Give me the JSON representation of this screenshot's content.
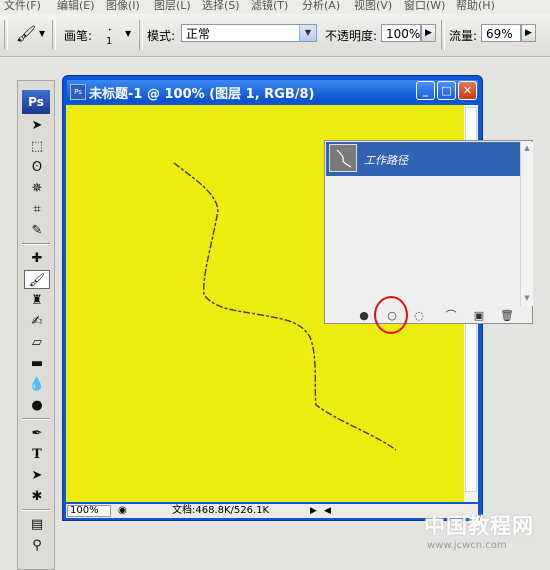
{
  "menu": [
    "文件(F)",
    "编辑(E)",
    "图像(I)",
    "图层(L)",
    "选择(S)",
    "滤镜(T)",
    "分析(A)",
    "视图(V)",
    "窗口(W)",
    "帮助(H)"
  ],
  "options": {
    "brush_label": "画笔:",
    "brush_size": "1",
    "mode_label": "模式:",
    "mode_value": "正常",
    "opacity_label": "不透明度:",
    "opacity_value": "100%",
    "flow_label": "流量:",
    "flow_value": "69%"
  },
  "toolbox": {
    "logo": "Ps",
    "tools": [
      "move-icon",
      "marquee-icon",
      "lasso-icon",
      "magic-wand-icon",
      "crop-icon",
      "slice-icon",
      "healing-brush-icon",
      "brush-icon",
      "clone-stamp-icon",
      "history-brush-icon",
      "eraser-icon",
      "gradient-icon",
      "blur-icon",
      "dodge-icon",
      "pen-icon",
      "type-icon",
      "path-selection-icon",
      "custom-shape-icon",
      "notes-icon",
      "eyedropper-icon"
    ],
    "active_tool": "brush-icon"
  },
  "document": {
    "title": "未标题-1 @ 100% (图层 1, RGB/8)",
    "canvas_color": "#ecec0f",
    "zoom": "100%",
    "doc_info": "文档:468.8K/526.1K"
  },
  "paths_panel": {
    "path_name": "工作路径",
    "footer_buttons": [
      "fill-path-icon",
      "stroke-path-icon",
      "load-selection-icon",
      "make-work-path-icon",
      "new-path-icon",
      "delete-path-icon"
    ]
  },
  "watermark": {
    "text": "中国教程网",
    "url": "www.jcwcn.com"
  },
  "colors": {
    "title_bar": "#0a58d6",
    "selection": "#3163b3",
    "highlight": "#e01010"
  }
}
